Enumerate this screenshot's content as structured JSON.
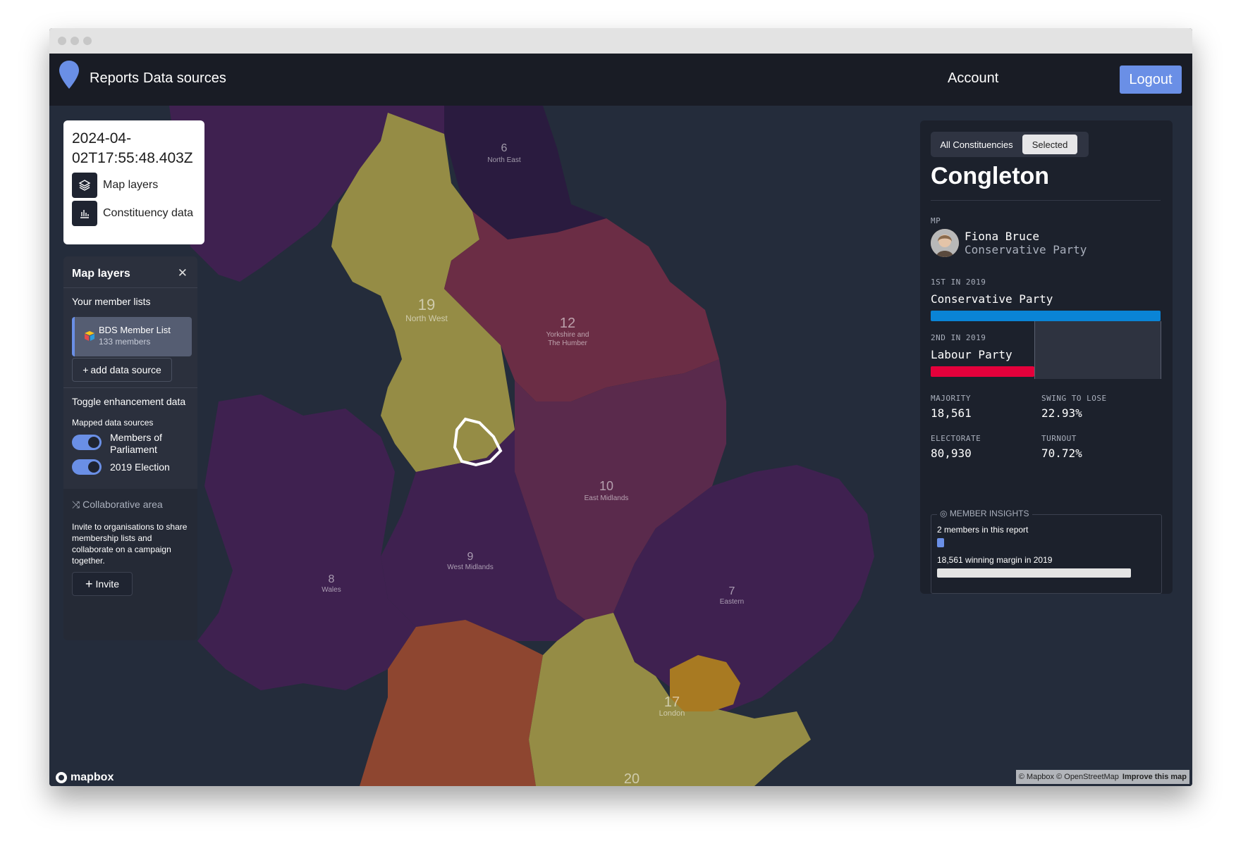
{
  "nav": {
    "reports": "Reports",
    "data_sources": "Data sources",
    "account": "Account",
    "logout": "Logout"
  },
  "report_card": {
    "date": "2024-04-02T17:55:48.403Z",
    "map_layers": "Map layers",
    "constituency_data": "Constituency data"
  },
  "layers_panel": {
    "title": "Map layers",
    "member_lists_heading": "Your member lists",
    "member_list": {
      "name": "BDS Member List",
      "count": "133 members"
    },
    "add_data_source": "add data source",
    "toggle_heading": "Toggle enhancement data",
    "mapped_sources_heading": "Mapped data sources",
    "toggles": [
      {
        "label": "Members of Parliament",
        "on": true
      },
      {
        "label": "2019 Election",
        "on": true
      }
    ],
    "collab_title": "Collaborative area",
    "collab_desc": "Invite to organisations to share membership lists and collaborate on a campaign together.",
    "invite": "Invite"
  },
  "map": {
    "regions": [
      {
        "count": "6",
        "name": "North East"
      },
      {
        "count": "19",
        "name": "North West"
      },
      {
        "count": "12",
        "name_lines": [
          "Yorkshire and",
          "The Humber"
        ]
      },
      {
        "count": "10",
        "name": "East Midlands"
      },
      {
        "count": "9",
        "name": "West Midlands"
      },
      {
        "count": "8",
        "name": "Wales"
      },
      {
        "count": "7",
        "name": "Eastern"
      },
      {
        "count": "17",
        "name": "London"
      },
      {
        "count": "20",
        "name": ""
      }
    ],
    "colors": {
      "olive": "#958c45",
      "maroon": "#6b2d45",
      "plum": "#5a2a4c",
      "purple": "#3f2150",
      "dark_purple": "#2a1b3f",
      "orange": "#8e4630",
      "gold": "#a87a22",
      "water": "#242c3b"
    },
    "attribution": "© Mapbox © OpenStreetMap",
    "improve": "Improve this map",
    "logo": "mapbox"
  },
  "info_panel": {
    "tabs": [
      "All Constituencies",
      "Selected"
    ],
    "active_tab": "Selected",
    "constituency": "Congleton",
    "mp_label": "MP",
    "mp_name": "Fiona Bruce",
    "mp_party": "Conservative Party",
    "first_label": "1ST IN 2019",
    "first_party": "Conservative Party",
    "first_color": "#0a84d6",
    "second_label": "2ND IN 2019",
    "second_party": "Labour Party",
    "second_color": "#e4003b",
    "second_share": 0.45,
    "majority_label": "MAJORITY",
    "majority_value": "18,561",
    "swing_label": "SWING TO LOSE",
    "swing_value": "22.93%",
    "electorate_label": "ELECTORATE",
    "electorate_value": "80,930",
    "turnout_label": "TURNOUT",
    "turnout_value": "70.72%",
    "insights_title": "MEMBER INSIGHTS",
    "members_in_report": "2 members in this report",
    "winning_margin": "18,561 winning margin in 2019"
  }
}
